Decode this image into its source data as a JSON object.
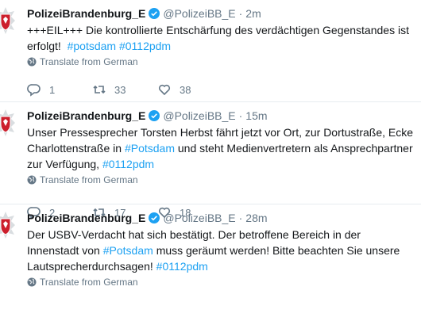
{
  "colors": {
    "link": "#1da1f2",
    "muted": "#657786",
    "verified": "#1da1f2"
  },
  "tweets": [
    {
      "name": "PolizeiBrandenburg_E",
      "handle": "@PolizeiBB_E",
      "dot": "·",
      "time": "2m",
      "text_a": "+++EIL+++ Die kontrollierte Entschärfung des verdächtigen Gegenstandes ist erfolgt!",
      "tag1": "#potsdam",
      "tag2": "#0112pdm",
      "translate": "Translate from German",
      "replies": "1",
      "retweets": "33",
      "likes": "38"
    },
    {
      "name": "PolizeiBrandenburg_E",
      "handle": "@PolizeiBB_E",
      "dot": "·",
      "time": "15m",
      "text_a": "Unser Pressesprecher Torsten Herbst fährt jetzt vor Ort, zur Dortustraße, Ecke Charlottenstraße in",
      "tag1": "#Potsdam",
      "text_b": "und steht Medienvertretern als Ansprechpartner zur Verfügung,",
      "tag2": "#0112pdm",
      "translate": "Translate from German",
      "replies": "2",
      "retweets": "17",
      "likes": "18"
    },
    {
      "name": "PolizeiBrandenburg_E",
      "handle": "@PolizeiBB_E",
      "dot": "·",
      "time": "28m",
      "text_a": "Der USBV-Verdacht hat sich bestätigt. Der betroffene Bereich in der Innenstadt von",
      "tag1": "#Potsdam",
      "text_b": "muss geräumt werden! Bitte beachten Sie unsere Lautsprecherdurchsagen!",
      "tag2": "#0112pdm",
      "translate": "Translate from German"
    }
  ]
}
